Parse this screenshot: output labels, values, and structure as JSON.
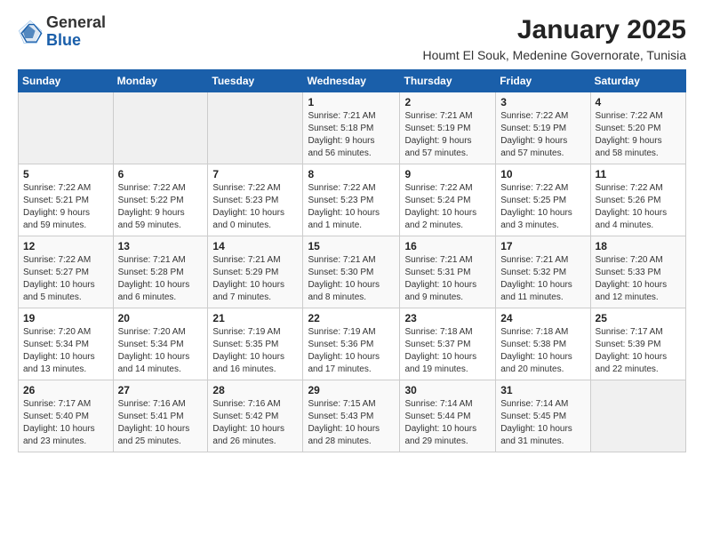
{
  "logo": {
    "general": "General",
    "blue": "Blue"
  },
  "header": {
    "title": "January 2025",
    "subtitle": "Houmt El Souk, Medenine Governorate, Tunisia"
  },
  "weekdays": [
    "Sunday",
    "Monday",
    "Tuesday",
    "Wednesday",
    "Thursday",
    "Friday",
    "Saturday"
  ],
  "weeks": [
    [
      {
        "day": "",
        "info": ""
      },
      {
        "day": "",
        "info": ""
      },
      {
        "day": "",
        "info": ""
      },
      {
        "day": "1",
        "info": "Sunrise: 7:21 AM\nSunset: 5:18 PM\nDaylight: 9 hours\nand 56 minutes."
      },
      {
        "day": "2",
        "info": "Sunrise: 7:21 AM\nSunset: 5:19 PM\nDaylight: 9 hours\nand 57 minutes."
      },
      {
        "day": "3",
        "info": "Sunrise: 7:22 AM\nSunset: 5:19 PM\nDaylight: 9 hours\nand 57 minutes."
      },
      {
        "day": "4",
        "info": "Sunrise: 7:22 AM\nSunset: 5:20 PM\nDaylight: 9 hours\nand 58 minutes."
      }
    ],
    [
      {
        "day": "5",
        "info": "Sunrise: 7:22 AM\nSunset: 5:21 PM\nDaylight: 9 hours\nand 59 minutes."
      },
      {
        "day": "6",
        "info": "Sunrise: 7:22 AM\nSunset: 5:22 PM\nDaylight: 9 hours\nand 59 minutes."
      },
      {
        "day": "7",
        "info": "Sunrise: 7:22 AM\nSunset: 5:23 PM\nDaylight: 10 hours\nand 0 minutes."
      },
      {
        "day": "8",
        "info": "Sunrise: 7:22 AM\nSunset: 5:23 PM\nDaylight: 10 hours\nand 1 minute."
      },
      {
        "day": "9",
        "info": "Sunrise: 7:22 AM\nSunset: 5:24 PM\nDaylight: 10 hours\nand 2 minutes."
      },
      {
        "day": "10",
        "info": "Sunrise: 7:22 AM\nSunset: 5:25 PM\nDaylight: 10 hours\nand 3 minutes."
      },
      {
        "day": "11",
        "info": "Sunrise: 7:22 AM\nSunset: 5:26 PM\nDaylight: 10 hours\nand 4 minutes."
      }
    ],
    [
      {
        "day": "12",
        "info": "Sunrise: 7:22 AM\nSunset: 5:27 PM\nDaylight: 10 hours\nand 5 minutes."
      },
      {
        "day": "13",
        "info": "Sunrise: 7:21 AM\nSunset: 5:28 PM\nDaylight: 10 hours\nand 6 minutes."
      },
      {
        "day": "14",
        "info": "Sunrise: 7:21 AM\nSunset: 5:29 PM\nDaylight: 10 hours\nand 7 minutes."
      },
      {
        "day": "15",
        "info": "Sunrise: 7:21 AM\nSunset: 5:30 PM\nDaylight: 10 hours\nand 8 minutes."
      },
      {
        "day": "16",
        "info": "Sunrise: 7:21 AM\nSunset: 5:31 PM\nDaylight: 10 hours\nand 9 minutes."
      },
      {
        "day": "17",
        "info": "Sunrise: 7:21 AM\nSunset: 5:32 PM\nDaylight: 10 hours\nand 11 minutes."
      },
      {
        "day": "18",
        "info": "Sunrise: 7:20 AM\nSunset: 5:33 PM\nDaylight: 10 hours\nand 12 minutes."
      }
    ],
    [
      {
        "day": "19",
        "info": "Sunrise: 7:20 AM\nSunset: 5:34 PM\nDaylight: 10 hours\nand 13 minutes."
      },
      {
        "day": "20",
        "info": "Sunrise: 7:20 AM\nSunset: 5:34 PM\nDaylight: 10 hours\nand 14 minutes."
      },
      {
        "day": "21",
        "info": "Sunrise: 7:19 AM\nSunset: 5:35 PM\nDaylight: 10 hours\nand 16 minutes."
      },
      {
        "day": "22",
        "info": "Sunrise: 7:19 AM\nSunset: 5:36 PM\nDaylight: 10 hours\nand 17 minutes."
      },
      {
        "day": "23",
        "info": "Sunrise: 7:18 AM\nSunset: 5:37 PM\nDaylight: 10 hours\nand 19 minutes."
      },
      {
        "day": "24",
        "info": "Sunrise: 7:18 AM\nSunset: 5:38 PM\nDaylight: 10 hours\nand 20 minutes."
      },
      {
        "day": "25",
        "info": "Sunrise: 7:17 AM\nSunset: 5:39 PM\nDaylight: 10 hours\nand 22 minutes."
      }
    ],
    [
      {
        "day": "26",
        "info": "Sunrise: 7:17 AM\nSunset: 5:40 PM\nDaylight: 10 hours\nand 23 minutes."
      },
      {
        "day": "27",
        "info": "Sunrise: 7:16 AM\nSunset: 5:41 PM\nDaylight: 10 hours\nand 25 minutes."
      },
      {
        "day": "28",
        "info": "Sunrise: 7:16 AM\nSunset: 5:42 PM\nDaylight: 10 hours\nand 26 minutes."
      },
      {
        "day": "29",
        "info": "Sunrise: 7:15 AM\nSunset: 5:43 PM\nDaylight: 10 hours\nand 28 minutes."
      },
      {
        "day": "30",
        "info": "Sunrise: 7:14 AM\nSunset: 5:44 PM\nDaylight: 10 hours\nand 29 minutes."
      },
      {
        "day": "31",
        "info": "Sunrise: 7:14 AM\nSunset: 5:45 PM\nDaylight: 10 hours\nand 31 minutes."
      },
      {
        "day": "",
        "info": ""
      }
    ]
  ]
}
